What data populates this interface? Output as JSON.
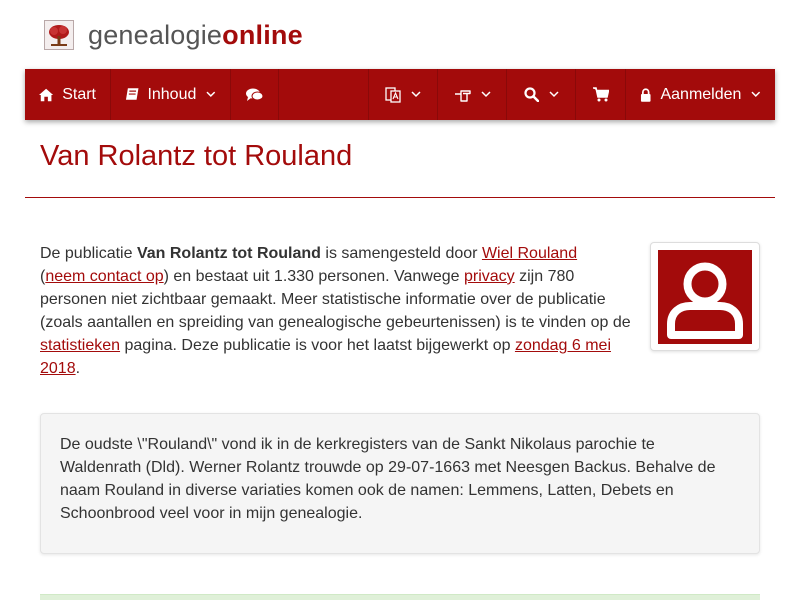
{
  "header": {
    "logo_text_plain": "genealogie",
    "logo_text_bold": "online"
  },
  "nav": {
    "start_label": "Start",
    "inhoud_label": "Inhoud",
    "login_label": "Aanmelden"
  },
  "page": {
    "title": "Van Rolantz tot Rouland"
  },
  "intro": {
    "t1": "De publicatie ",
    "pub_name": "Van Rolantz tot Rouland",
    "t2": " is samengesteld door ",
    "author_link": "Wiel Rouland",
    "t3": "(",
    "contact_link": "neem contact op",
    "t4": ") en bestaat uit 1.330 personen. Vanwege ",
    "privacy_link": "privacy",
    "t5": " zijn 780 personen niet zichtbaar gemaakt. Meer statistische informatie over de publicatie (zoals aantallen en spreiding van genealogische gebeurtenissen) is te vinden op de ",
    "stats_link": "statistieken",
    "t6": " pagina. Deze publicatie is voor het laatst bijgewerkt op ",
    "date_link": "zondag 6 mei 2018",
    "t7": "."
  },
  "description": "De oudste \\\"Rouland\\\" vond ik in de kerkregisters van de Sankt Nikolaus parochie te Waldenrath (Dld). Werner Rolantz trouwde op 29-07-1663 met Neesgen Backus. Behalve de naam Rouland in diverse variaties komen ook de namen: Lemmens, Latten, Debets en Schoonbrood veel voor in mijn genealogie.",
  "icons": {
    "logo": "family-tree-icon",
    "start": "home-icon",
    "inhoud": "book-icon",
    "forum": "comments-icon",
    "language": "language-icon",
    "pointer": "hand-pointer-icon",
    "search": "search-icon",
    "cart": "shopping-cart-icon",
    "login": "lock-icon",
    "avatar": "user-silhouette-icon"
  },
  "colors": {
    "brand": "#a30b0b",
    "link": "#a30b0b",
    "text": "#333333"
  }
}
